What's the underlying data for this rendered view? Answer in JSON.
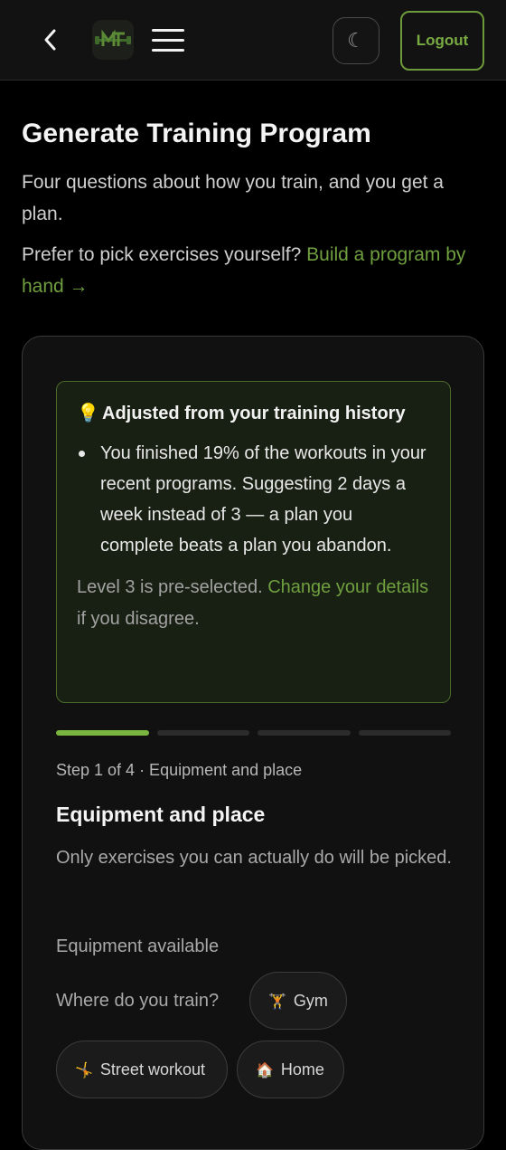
{
  "header": {
    "back_icon": "chevron-left-icon",
    "logo_text": "MT",
    "menu_icon": "hamburger-icon",
    "theme_icon": "☾",
    "logout_label": "Logout"
  },
  "page": {
    "title": "Generate Training Program",
    "intro": "Four questions about how you train, and you get a plan.",
    "manual_prefix": "Prefer to pick exercises yourself?",
    "manual_link": "Build a program by hand →"
  },
  "notice": {
    "icon": "💡",
    "title": "Adjusted from your training history",
    "items": [
      "You finished 19% of the workouts in your recent programs. Suggesting 2 days a week instead of 3 — a plan you complete beats a plan you abandon."
    ],
    "footer_prefix": "Level 3 is pre-selected.",
    "footer_link": "Change your details",
    "footer_suffix": "if you disagree."
  },
  "wizard": {
    "current_step": 1,
    "total_steps": 4,
    "step_label": "Step 1 of 4 · Equipment and place",
    "step_title": "Equipment and place",
    "step_description": "Only exercises you can actually do will be picked.",
    "equipment_label": "Equipment available",
    "where_label": "Where do you train?",
    "options": [
      {
        "icon": "🏋",
        "label": "Gym"
      },
      {
        "icon": "🤸",
        "label": "Street workout"
      },
      {
        "icon": "🏠",
        "label": "Home"
      }
    ]
  },
  "colors": {
    "accent": "#79ab42",
    "background": "#000000",
    "card": "#111111"
  }
}
